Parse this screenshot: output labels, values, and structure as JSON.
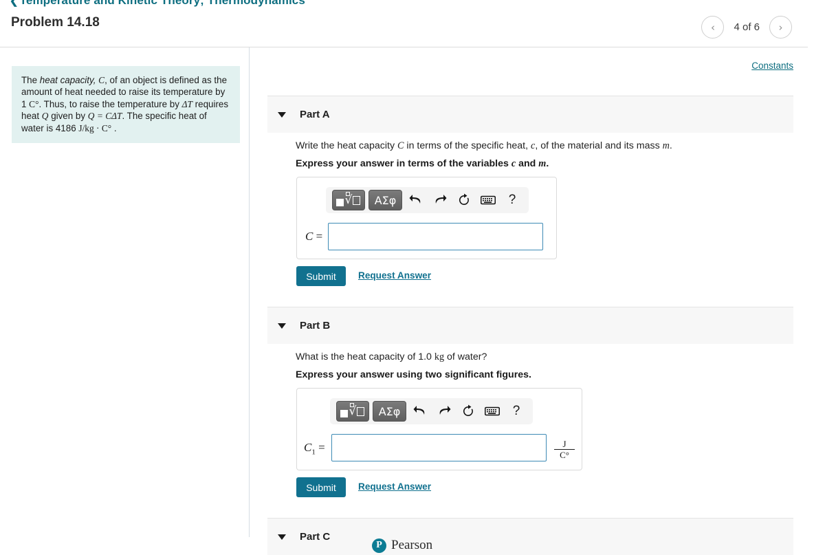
{
  "breadcrumb": {
    "back_icon": "chevron-left-icon",
    "label": "Temperature and Kinetic Theory; Thermodynamics"
  },
  "header": {
    "problem_title": "Problem 14.18",
    "prev_icon": "‹",
    "next_icon": "›",
    "pager_label": "4 of 6"
  },
  "sidebar": {
    "problem_statement": "The heat capacity, C, of an object is defined as the amount of heat needed to raise its temperature by 1 C°. Thus, to raise the temperature by ΔT requires heat Q given by Q = CΔT. The specific heat of water is 4186 J/kg · C° .",
    "statement_parts": {
      "t1": "The ",
      "em1": "heat capacity,",
      "m1": "C",
      "t2": ", of an object is defined as the amount of heat needed to raise its temperature by 1 ",
      "m2": "C°",
      "t3": ". Thus, to raise the temperature by ",
      "m3": "ΔT",
      "t4": " requires heat ",
      "m4": "Q",
      "t5": " given by ",
      "m5": "Q = CΔT",
      "t6": ". The specific heat of water is 4186 ",
      "m6": "J/kg · C°",
      "t7": " ."
    },
    "bg_color": "#e2f1f0"
  },
  "main": {
    "constants_link": "Constants",
    "parts": [
      {
        "id": "a",
        "label": "Part A",
        "caret_icon": "caret-down-icon",
        "question_prefix": "Write the heat capacity ",
        "question_math1": "C",
        "question_mid": " in terms of the specific heat, ",
        "question_math2": "c",
        "question_mid2": ", of the material and its mass ",
        "question_math3": "m",
        "question_suffix": ".",
        "instruction_prefix": "Express your answer in terms of the variables ",
        "instruction_math1": "c",
        "instruction_mid": " and ",
        "instruction_math2": "m",
        "instruction_suffix": ".",
        "answer_label": "C",
        "answer_subscript": "",
        "answer_equals": "=",
        "answer_value": "",
        "unit_numerator": "",
        "unit_denominator": "",
        "submit_label": "Submit",
        "request_label": "Request Answer"
      },
      {
        "id": "b",
        "label": "Part B",
        "caret_icon": "caret-down-icon",
        "question_prefix": "What is the heat capacity of 1.0 ",
        "question_math1": "kg",
        "question_mid": " of water?",
        "question_math2": "",
        "question_mid2": "",
        "question_math3": "",
        "question_suffix": "",
        "instruction_prefix": "Express your answer using two significant figures.",
        "instruction_math1": "",
        "instruction_mid": "",
        "instruction_math2": "",
        "instruction_suffix": "",
        "answer_label": "C",
        "answer_subscript": "1",
        "answer_equals": "=",
        "answer_value": "",
        "unit_numerator": "J",
        "unit_denominator": "C°",
        "submit_label": "Submit",
        "request_label": "Request Answer"
      },
      {
        "id": "c",
        "label": "Part C",
        "caret_icon": "caret-down-icon"
      }
    ],
    "toolbar": {
      "template_icon": "square-root-template-icon",
      "greek_label": "ΑΣφ",
      "undo_icon": "undo-arrow-icon",
      "redo_icon": "redo-arrow-icon",
      "reset_icon": "reset-circular-arrow-icon",
      "keyboard_icon": "keyboard-icon",
      "help_label": "?"
    }
  },
  "footer": {
    "logo_mark": "P",
    "logo_text": "Pearson"
  },
  "colors": {
    "accent_teal": "#11718f",
    "link_teal": "#0d6e80",
    "statement_bg": "#e2f1f0",
    "input_border": "#3d8ab5",
    "part_header_bg": "#f7f7f7"
  }
}
